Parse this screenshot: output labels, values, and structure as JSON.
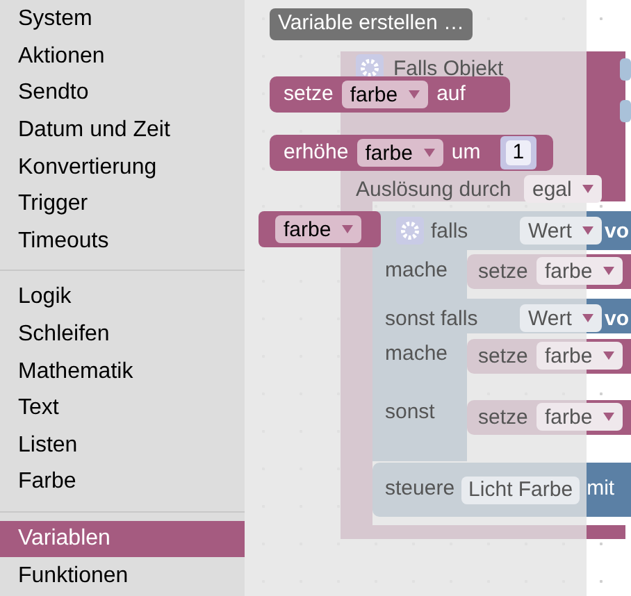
{
  "toolbox": {
    "groups": [
      [
        {
          "label": "System",
          "selected": false
        },
        {
          "label": "Aktionen",
          "selected": false
        },
        {
          "label": "Sendto",
          "selected": false
        },
        {
          "label": "Datum und Zeit",
          "selected": false
        },
        {
          "label": "Konvertierung",
          "selected": false
        },
        {
          "label": "Trigger",
          "selected": false
        },
        {
          "label": "Timeouts",
          "selected": false
        }
      ],
      [
        {
          "label": "Logik",
          "selected": false
        },
        {
          "label": "Schleifen",
          "selected": false
        },
        {
          "label": "Mathematik",
          "selected": false
        },
        {
          "label": "Text",
          "selected": false
        },
        {
          "label": "Listen",
          "selected": false
        },
        {
          "label": "Farbe",
          "selected": false
        }
      ],
      [
        {
          "label": "Variablen",
          "selected": true
        },
        {
          "label": "Funktionen",
          "selected": false
        }
      ]
    ]
  },
  "flyout": {
    "button": "Variable erstellen …",
    "blocks": [
      {
        "kind": "setter",
        "label": "setze",
        "variable": "farbe",
        "suffix": "auf"
      },
      {
        "kind": "change",
        "label": "erhöhe",
        "variable": "farbe",
        "suffix": "um",
        "value": "1"
      },
      {
        "kind": "getter",
        "variable": "farbe"
      }
    ]
  },
  "workspace": {
    "event_block": {
      "title": "Falls Objekt",
      "trigger_label": "Auslösung durch",
      "trigger_value": "egal"
    },
    "if_block": {
      "rows": [
        {
          "kind": "condition",
          "label": "falls",
          "dropdown": "Wert",
          "tail": "vo"
        },
        {
          "kind": "statement",
          "label": "mache",
          "block": {
            "label": "setze",
            "variable": "farbe"
          }
        },
        {
          "kind": "condition",
          "label": "sonst falls",
          "dropdown": "Wert",
          "tail": "vo"
        },
        {
          "kind": "statement",
          "label": "mache",
          "block": {
            "label": "setze",
            "variable": "farbe"
          }
        },
        {
          "kind": "statement",
          "label": "sonst",
          "block": {
            "label": "setze",
            "variable": "farbe"
          }
        }
      ]
    },
    "control_block": {
      "label": "steuere",
      "field": "Licht Farbe",
      "tail": "mit"
    }
  }
}
